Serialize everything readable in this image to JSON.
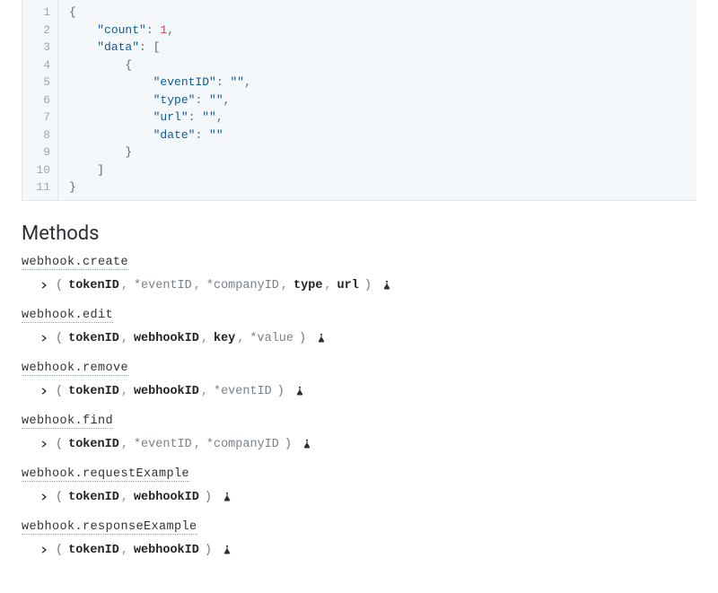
{
  "code": {
    "lines": [
      {
        "n": 1,
        "indent": 0,
        "frags": [
          {
            "t": "{",
            "c": "punc"
          }
        ]
      },
      {
        "n": 2,
        "indent": 1,
        "frags": [
          {
            "t": "\"count\"",
            "c": "key"
          },
          {
            "t": ": ",
            "c": "punc"
          },
          {
            "t": "1",
            "c": "num"
          },
          {
            "t": ",",
            "c": "comma"
          }
        ]
      },
      {
        "n": 3,
        "indent": 1,
        "frags": [
          {
            "t": "\"data\"",
            "c": "key"
          },
          {
            "t": ": [",
            "c": "punc"
          }
        ]
      },
      {
        "n": 4,
        "indent": 2,
        "frags": [
          {
            "t": "{",
            "c": "punc"
          }
        ]
      },
      {
        "n": 5,
        "indent": 3,
        "frags": [
          {
            "t": "\"eventID\"",
            "c": "key"
          },
          {
            "t": ": ",
            "c": "punc"
          },
          {
            "t": "\"\"",
            "c": "str"
          },
          {
            "t": ",",
            "c": "comma"
          }
        ]
      },
      {
        "n": 6,
        "indent": 3,
        "frags": [
          {
            "t": "\"type\"",
            "c": "key"
          },
          {
            "t": ": ",
            "c": "punc"
          },
          {
            "t": "\"\"",
            "c": "str"
          },
          {
            "t": ",",
            "c": "comma"
          }
        ]
      },
      {
        "n": 7,
        "indent": 3,
        "frags": [
          {
            "t": "\"url\"",
            "c": "key"
          },
          {
            "t": ": ",
            "c": "punc"
          },
          {
            "t": "\"\"",
            "c": "str"
          },
          {
            "t": ",",
            "c": "comma"
          }
        ]
      },
      {
        "n": 8,
        "indent": 3,
        "frags": [
          {
            "t": "\"date\"",
            "c": "key"
          },
          {
            "t": ": ",
            "c": "punc"
          },
          {
            "t": "\"\"",
            "c": "str"
          }
        ]
      },
      {
        "n": 9,
        "indent": 2,
        "frags": [
          {
            "t": "}",
            "c": "punc"
          }
        ]
      },
      {
        "n": 10,
        "indent": 1,
        "frags": [
          {
            "t": "]",
            "c": "punc"
          }
        ]
      },
      {
        "n": 11,
        "indent": 0,
        "frags": [
          {
            "t": "}",
            "c": "punc"
          }
        ]
      }
    ],
    "indent_unit": "    "
  },
  "sections": {
    "methods_heading": "Methods"
  },
  "methods": [
    {
      "name": "webhook.create",
      "params": [
        {
          "label": "tokenID",
          "req": true
        },
        {
          "label": "eventID",
          "req": false
        },
        {
          "label": "companyID",
          "req": false
        },
        {
          "label": "type",
          "req": true
        },
        {
          "label": "url",
          "req": true
        }
      ]
    },
    {
      "name": "webhook.edit",
      "params": [
        {
          "label": "tokenID",
          "req": true
        },
        {
          "label": "webhookID",
          "req": true
        },
        {
          "label": "key",
          "req": true
        },
        {
          "label": "value",
          "req": false
        }
      ]
    },
    {
      "name": "webhook.remove",
      "params": [
        {
          "label": "tokenID",
          "req": true
        },
        {
          "label": "webhookID",
          "req": true
        },
        {
          "label": "eventID",
          "req": false
        }
      ]
    },
    {
      "name": "webhook.find",
      "params": [
        {
          "label": "tokenID",
          "req": true
        },
        {
          "label": "eventID",
          "req": false
        },
        {
          "label": "companyID",
          "req": false
        }
      ]
    },
    {
      "name": "webhook.requestExample",
      "params": [
        {
          "label": "tokenID",
          "req": true
        },
        {
          "label": "webhookID",
          "req": true
        }
      ]
    },
    {
      "name": "webhook.responseExample",
      "params": [
        {
          "label": "tokenID",
          "req": true
        },
        {
          "label": "webhookID",
          "req": true
        }
      ]
    }
  ],
  "icons": {
    "chevron": "chevron-right-icon",
    "flask": "flask-icon"
  }
}
